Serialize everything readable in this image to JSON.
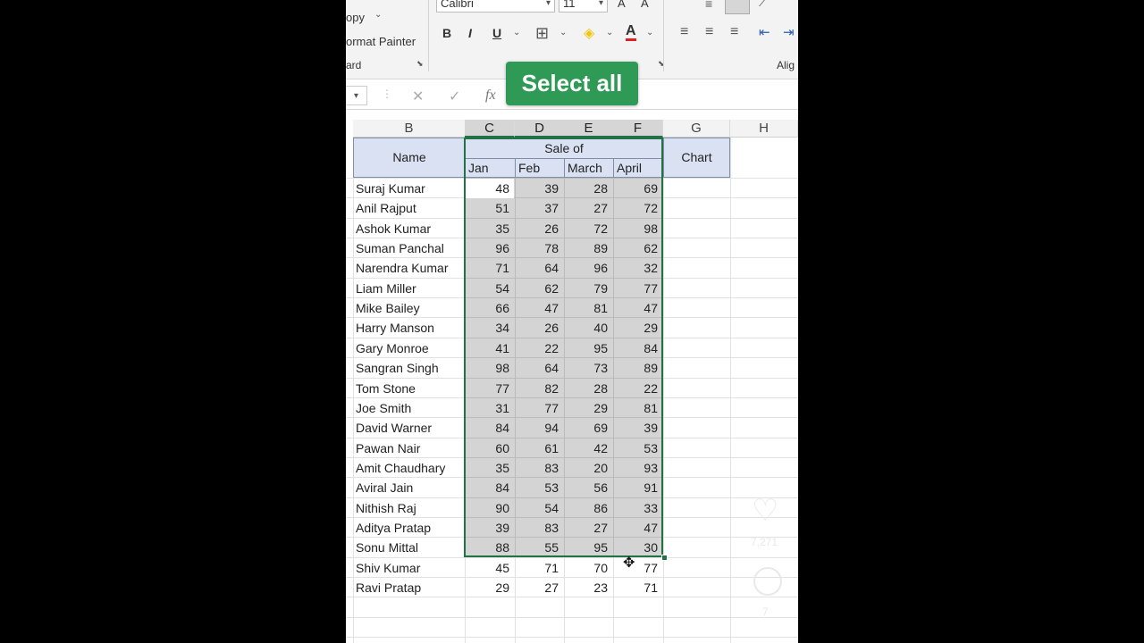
{
  "ribbon": {
    "copy_label": "opy",
    "format_painter_label": "ormat Painter",
    "clipboard_label": "ard",
    "font_name": "Calibri",
    "font_size": "11",
    "alignment_label": "Alig"
  },
  "callout": {
    "text": "Select all"
  },
  "columns": [
    "B",
    "C",
    "D",
    "E",
    "F",
    "G",
    "H"
  ],
  "table": {
    "name_header": "Name",
    "sale_header": "Sale of",
    "month_headers": [
      "Jan",
      "Feb",
      "March",
      "April"
    ],
    "chart_header": "Chart"
  },
  "rows": [
    {
      "name": "Suraj Kumar",
      "jan": "48",
      "feb": "39",
      "march": "28",
      "april": "69"
    },
    {
      "name": "Anil Rajput",
      "jan": "51",
      "feb": "37",
      "march": "27",
      "april": "72"
    },
    {
      "name": "Ashok Kumar",
      "jan": "35",
      "feb": "26",
      "march": "72",
      "april": "98"
    },
    {
      "name": "Suman Panchal",
      "jan": "96",
      "feb": "78",
      "march": "89",
      "april": "62"
    },
    {
      "name": "Narendra Kumar",
      "jan": "71",
      "feb": "64",
      "march": "96",
      "april": "32"
    },
    {
      "name": "Liam Miller",
      "jan": "54",
      "feb": "62",
      "march": "79",
      "april": "77"
    },
    {
      "name": "Mike Bailey",
      "jan": "66",
      "feb": "47",
      "march": "81",
      "april": "47"
    },
    {
      "name": "Harry Manson",
      "jan": "34",
      "feb": "26",
      "march": "40",
      "april": "29"
    },
    {
      "name": "Gary Monroe",
      "jan": "41",
      "feb": "22",
      "march": "95",
      "april": "84"
    },
    {
      "name": "Sangran Singh",
      "jan": "98",
      "feb": "64",
      "march": "73",
      "april": "89"
    },
    {
      "name": "Tom Stone",
      "jan": "77",
      "feb": "82",
      "march": "28",
      "april": "22"
    },
    {
      "name": "Joe Smith",
      "jan": "31",
      "feb": "77",
      "march": "29",
      "april": "81"
    },
    {
      "name": "David Warner",
      "jan": "84",
      "feb": "94",
      "march": "69",
      "april": "39"
    },
    {
      "name": "Pawan Nair",
      "jan": "60",
      "feb": "61",
      "march": "42",
      "april": "53"
    },
    {
      "name": "Amit Chaudhary",
      "jan": "35",
      "feb": "83",
      "march": "20",
      "april": "93"
    },
    {
      "name": "Aviral Jain",
      "jan": "84",
      "feb": "53",
      "march": "56",
      "april": "91"
    },
    {
      "name": "Nithish Raj",
      "jan": "90",
      "feb": "54",
      "march": "86",
      "april": "33"
    },
    {
      "name": "Aditya Pratap",
      "jan": "39",
      "feb": "83",
      "march": "27",
      "april": "47"
    },
    {
      "name": "Sonu Mittal",
      "jan": "88",
      "feb": "55",
      "march": "95",
      "april": "30"
    },
    {
      "name": "Shiv Kumar",
      "jan": "45",
      "feb": "71",
      "march": "70",
      "april": "77"
    },
    {
      "name": "Ravi Pratap",
      "jan": "29",
      "feb": "27",
      "march": "23",
      "april": "71"
    }
  ],
  "overlay": {
    "like_count": "7,271",
    "comment_count": "7"
  },
  "colors": {
    "accent": "#217346",
    "callout": "#2e9a55",
    "header_fill": "#d9e1f2"
  }
}
